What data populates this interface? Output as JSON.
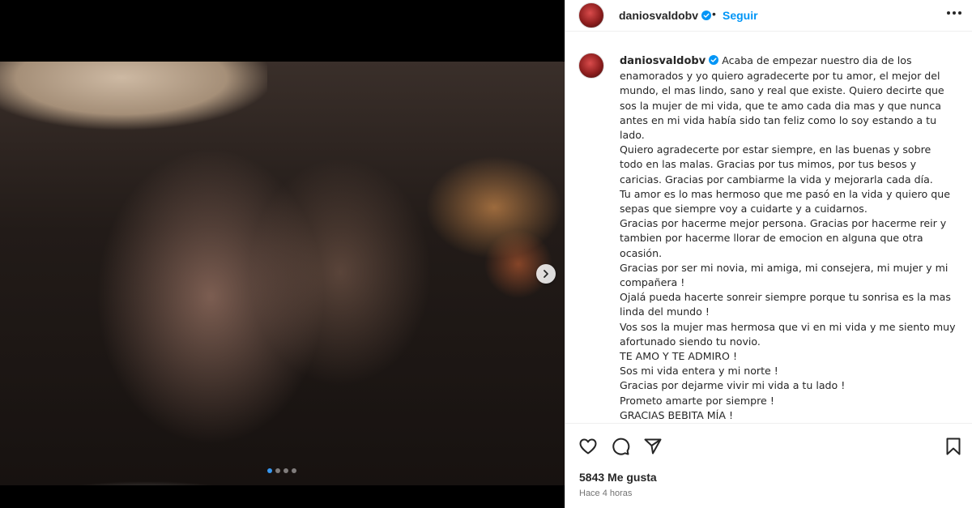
{
  "post": {
    "username": "daniosvaldobv",
    "follow_label": "Seguir",
    "separator": "•",
    "verified_icon": "verified-badge-icon",
    "accent_color": "#0095f6",
    "caption_lines": [
      "Acaba de empezar nuestro dia de los enamorados y yo quiero agradecerte por tu amor, el mejor del mundo, el mas lindo, sano y real que existe. Quiero decirte que sos la mujer de mi vida, que te amo cada dia mas y que nunca antes en mi vida había sido tan feliz como lo soy estando a tu lado.",
      "Quiero agradecerte por estar siempre, en las buenas y sobre todo en las malas. Gracias por tus mimos, por tus besos y caricias. Gracias por cambiarme la vida y mejorarla cada día.",
      "Tu amor es lo mas hermoso que me pasó en la vida y quiero que sepas que siempre voy a cuidarte y a cuidarnos.",
      "Gracias por hacerme mejor persona. Gracias por hacerme reir y tambien por hacerme llorar de emocion en alguna que otra ocasión.",
      "Gracias por ser mi novia, mi amiga, mi consejera, mi mujer y mi compañera !",
      "Ojalá pueda hacerte sonreir siempre porque tu sonrisa es la mas linda del mundo !",
      "Vos sos la mujer mas hermosa que vi en mi vida y me siento muy afortunado siendo tu novio.",
      "TE AMO Y TE ADMIRO !",
      "Sos mi vida entera y mi norte !",
      "Gracias por dejarme vivir mi vida a tu lado !",
      "Prometo amarte por siempre !",
      "GRACIAS BEBITA MÍA !"
    ],
    "likes": "5843 Me gusta",
    "timestamp": "Hace 4 horas",
    "carousel": {
      "count": 4,
      "active_index": 0
    }
  }
}
